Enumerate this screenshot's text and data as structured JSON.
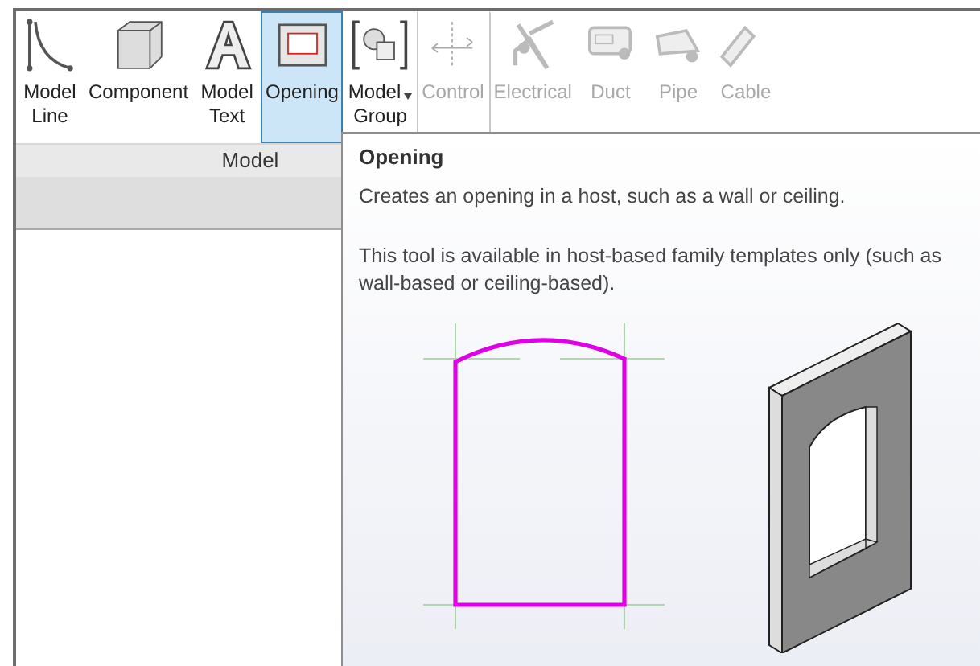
{
  "ribbon": {
    "tools": [
      {
        "kind": "model-line",
        "lines": [
          "Model",
          "Line"
        ],
        "selected": false,
        "disabled": false
      },
      {
        "kind": "component",
        "lines": [
          "Component"
        ],
        "selected": false,
        "disabled": false
      },
      {
        "kind": "model-text",
        "lines": [
          "Model",
          "Text"
        ],
        "selected": false,
        "disabled": false
      },
      {
        "kind": "opening",
        "lines": [
          "Opening"
        ],
        "selected": true,
        "disabled": false
      },
      {
        "kind": "model-group",
        "lines": [
          "Model",
          "Group"
        ],
        "selected": false,
        "disabled": false,
        "dropdown": true
      },
      {
        "kind": "control",
        "lines": [
          "Control"
        ],
        "selected": false,
        "disabled": true,
        "separator": true
      },
      {
        "kind": "electrical",
        "lines": [
          "Electrical"
        ],
        "selected": false,
        "disabled": true,
        "separator": true
      },
      {
        "kind": "duct",
        "lines": [
          "Duct"
        ],
        "selected": false,
        "disabled": true
      },
      {
        "kind": "pipe",
        "lines": [
          "Pipe"
        ],
        "selected": false,
        "disabled": true
      },
      {
        "kind": "cable",
        "lines": [
          "Cable"
        ],
        "selected": false,
        "disabled": true
      }
    ],
    "panel_label": "Model"
  },
  "tooltip": {
    "title": "Opening",
    "description": "Creates an opening in a host, such as a wall or ceiling.",
    "note": "This tool is available in host-based family templates only (such as wall-based or ceiling-based)."
  }
}
